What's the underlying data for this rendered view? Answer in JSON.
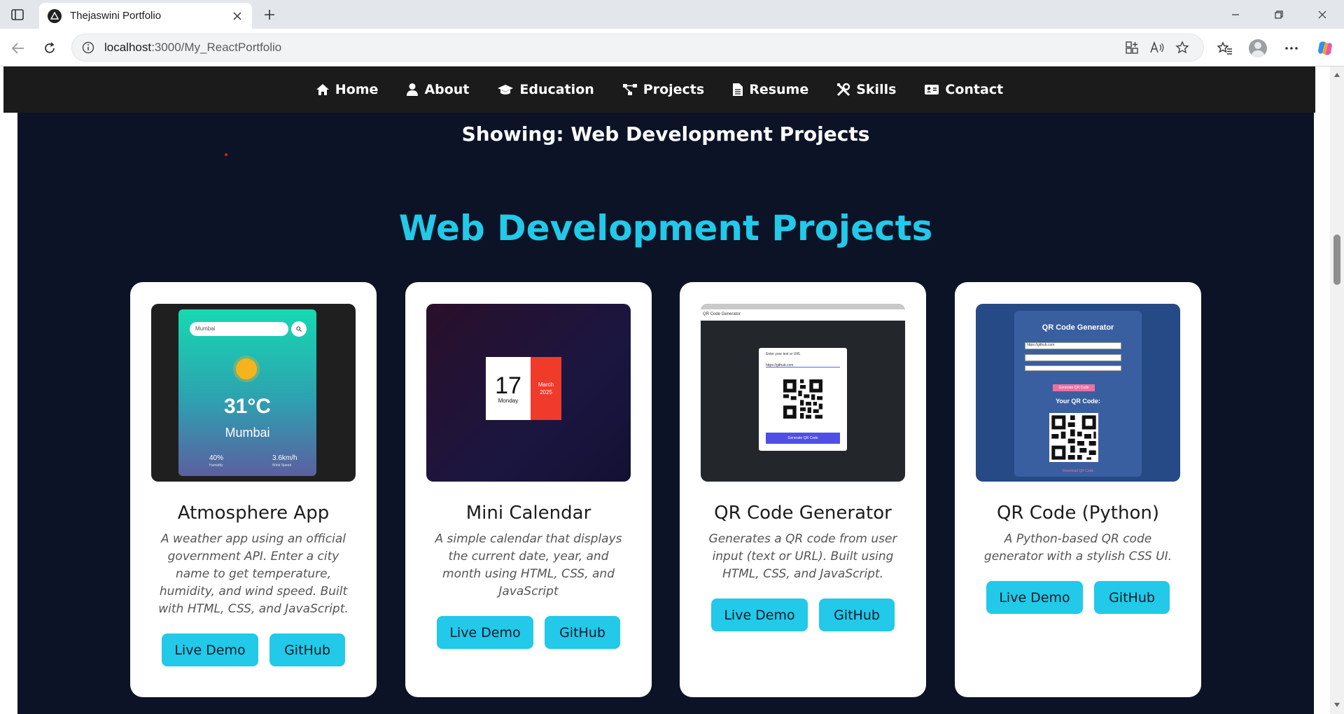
{
  "browser": {
    "tab_title": "Thejaswini Portfolio",
    "url_host": "localhost",
    "url_rest": ":3000/My_ReactPortfolio"
  },
  "nav": {
    "items": [
      {
        "label": "Home",
        "icon": "home-icon"
      },
      {
        "label": "About",
        "icon": "user-icon"
      },
      {
        "label": "Education",
        "icon": "graduation-cap-icon"
      },
      {
        "label": "Projects",
        "icon": "project-diagram-icon"
      },
      {
        "label": "Resume",
        "icon": "file-icon"
      },
      {
        "label": "Skills",
        "icon": "tools-icon"
      },
      {
        "label": "Contact",
        "icon": "address-card-icon"
      }
    ]
  },
  "showing_text": "Showing: Web Development Projects",
  "section_title": "Web Development Projects",
  "colors": {
    "accent": "#22c9e8",
    "page_bg": "#0c1327",
    "nav_bg": "#1b1b1b"
  },
  "projects": [
    {
      "title": "Atmosphere App",
      "description": "A weather app using an official government API. Enter a city name to get temperature, humidity, and wind speed. Built with HTML, CSS, and JavaScript.",
      "demo_label": "Live Demo",
      "github_label": "GitHub",
      "thumb": {
        "search": "Mumbai",
        "temp": "31°C",
        "city": "Mumbai",
        "humidity": "40%",
        "humidity_label": "Humidity",
        "wind": "3.6km/h",
        "wind_label": "Wind Speed"
      }
    },
    {
      "title": "Mini Calendar",
      "description": "A simple calendar that displays the current date, year, and month using HTML, CSS, and JavaScript",
      "demo_label": "Live Demo",
      "github_label": "GitHub",
      "thumb": {
        "day": "17",
        "weekday": "Monday",
        "month": "March",
        "year": "2025"
      }
    },
    {
      "title": "QR Code Generator",
      "description": "Generates a QR code from user input (text or URL). Built using HTML, CSS, and JavaScript.",
      "demo_label": "Live Demo",
      "github_label": "GitHub",
      "thumb": {
        "bar": "QR Code Generator",
        "label": "Enter your text or URL",
        "value": "https://github.com",
        "button": "Generate QR Code"
      }
    },
    {
      "title": "QR Code (Python)",
      "description": "A Python-based QR code generator with a stylish CSS UI.",
      "demo_label": "Live Demo",
      "github_label": "GitHub",
      "thumb": {
        "title": "QR Code Generator",
        "field": "https://github.com",
        "button": "Generate QR Code",
        "label": "Your QR Code:",
        "download": "Download QR Code"
      }
    }
  ]
}
